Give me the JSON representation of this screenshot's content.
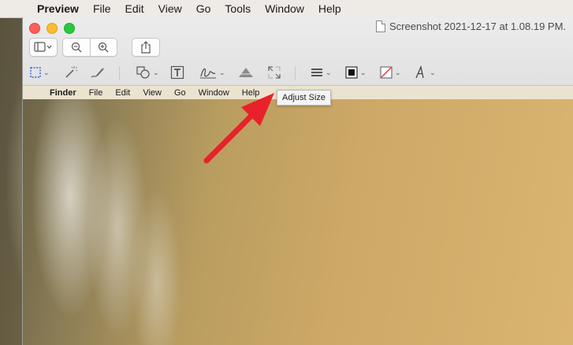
{
  "menubar": {
    "app": "Preview",
    "items": [
      "File",
      "Edit",
      "View",
      "Go",
      "Tools",
      "Window",
      "Help"
    ]
  },
  "window": {
    "title": "Screenshot 2021-12-17 at 1.08.19 PM."
  },
  "inner_menubar": {
    "app": "Finder",
    "items": [
      "File",
      "Edit",
      "View",
      "Go",
      "Window",
      "Help"
    ]
  },
  "tooltip": {
    "text": "Adjust Size"
  },
  "colors": {
    "annotation_arrow": "#e8212b",
    "traffic_red": "#fe5f57",
    "traffic_yellow": "#febc2e",
    "traffic_green": "#28c840"
  },
  "icons": [
    "apple-icon",
    "sidebar-icon",
    "zoom-out-icon",
    "zoom-in-icon",
    "share-icon",
    "rectangular-selection-icon",
    "instant-alpha-icon",
    "sketch-icon",
    "shapes-icon",
    "text-icon",
    "sign-icon",
    "adjust-color-icon",
    "adjust-size-icon",
    "line-style-icon",
    "border-color-icon",
    "fill-color-icon",
    "text-style-icon"
  ]
}
